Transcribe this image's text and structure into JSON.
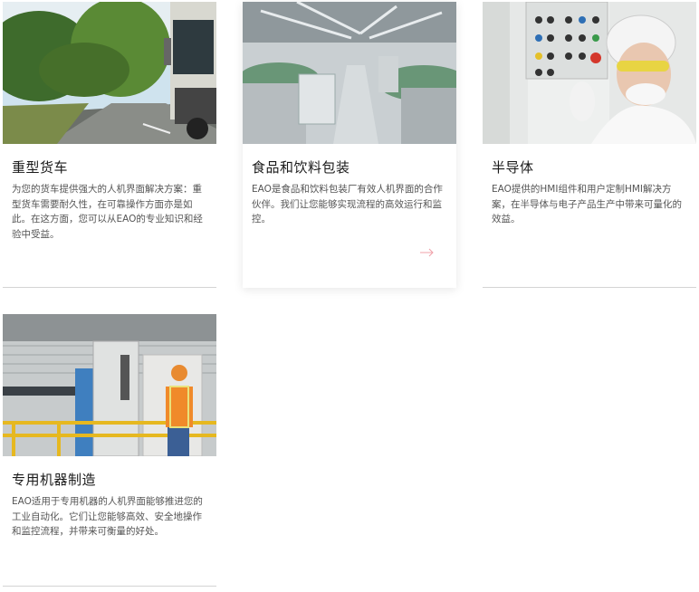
{
  "cards": [
    {
      "title": "重型货车",
      "description": "为您的货车提供强大的人机界面解决方案：重型货车需要耐久性，在可靠操作方面亦是如此。在这方面，您可以从EAO的专业知识和经验中受益。",
      "image_alt": "truck-on-road-photo"
    },
    {
      "title": "食品和饮料包装",
      "description": "EAO是食品和饮料包装厂有效人机界面的合作伙伴。我们让您能够实现流程的高效运行和监控。",
      "image_alt": "bottling-plant-photo",
      "arrow_icon": "arrow-right-icon"
    },
    {
      "title": "半导体",
      "description": "EAO提供的HMI组件和用户定制HMI解决方案，在半导体与电子产品生产中带来可量化的效益。",
      "image_alt": "cleanroom-operator-photo"
    },
    {
      "title": "专用机器制造",
      "description": "EAO适用于专用机器的人机界面能够推进您的工业自动化。它们让您能够高效、安全地操作和监控流程，并带来可衡量的好处。",
      "image_alt": "machine-operator-photo"
    }
  ],
  "colors": {
    "arrow": "#f0a0a8",
    "divider": "#d4d4d4",
    "title": "#1a1a1a",
    "text": "#555555"
  }
}
